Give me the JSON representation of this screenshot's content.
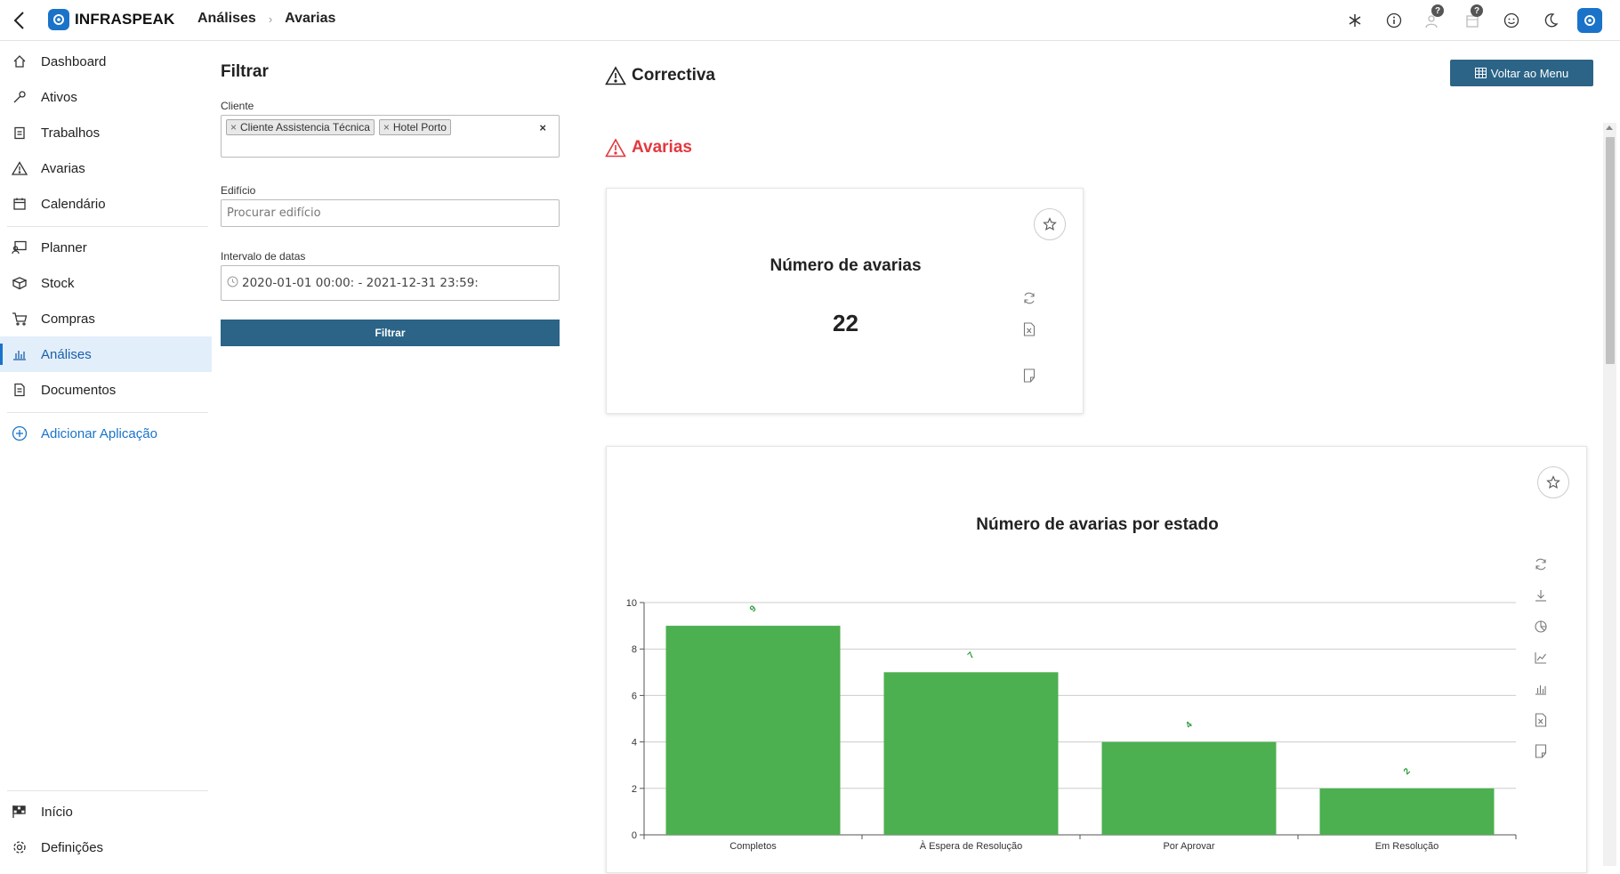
{
  "header": {
    "brand": "INFRASPEAK",
    "breadcrumb": [
      "Análises",
      "Avarias"
    ],
    "icons": [
      "asterisk-icon",
      "info-icon",
      "team-help-icon",
      "calendar-help-icon",
      "smiley-icon",
      "moon-icon",
      "app-avatar-icon"
    ]
  },
  "sidebar": {
    "items": [
      {
        "label": "Dashboard",
        "icon": "home-icon"
      },
      {
        "label": "Ativos",
        "icon": "wrench-icon"
      },
      {
        "label": "Trabalhos",
        "icon": "clipboard-icon"
      },
      {
        "label": "Avarias",
        "icon": "warning-icon"
      },
      {
        "label": "Calendário",
        "icon": "calendar-icon"
      },
      {
        "label": "Planner",
        "icon": "planner-icon"
      },
      {
        "label": "Stock",
        "icon": "box-icon"
      },
      {
        "label": "Compras",
        "icon": "cart-icon"
      },
      {
        "label": "Análises",
        "icon": "bar-chart-icon",
        "active": true
      },
      {
        "label": "Documentos",
        "icon": "document-icon"
      }
    ],
    "add_app": "Adicionar Aplicação",
    "bottom": [
      {
        "label": "Início",
        "icon": "flag-icon"
      },
      {
        "label": "Definições",
        "icon": "settings-icon"
      }
    ]
  },
  "filter": {
    "title": "Filtrar",
    "client_label": "Cliente",
    "client_tags": [
      "Cliente Assistencia Técnica",
      "Hotel Porto"
    ],
    "clear": "×",
    "building_label": "Edifício",
    "building_placeholder": "Procurar edifício",
    "date_label": "Intervalo de datas",
    "date_value": "2020-01-01 00:00: - 2021-12-31 23:59:",
    "button": "Filtrar"
  },
  "main": {
    "title": "Correctiva",
    "back_button": "Voltar ao Menu",
    "section_title": "Avarias"
  },
  "kpi_card": {
    "title": "Número de avarias",
    "value": "22"
  },
  "chart_card": {
    "title": "Número de avarias por estado"
  },
  "chart_data": {
    "type": "bar",
    "title": "Número de avarias por estado",
    "categories": [
      "Completos",
      "À Espera de Resolução",
      "Por Aprovar",
      "Em Resolução"
    ],
    "values": [
      9,
      7,
      4,
      2
    ],
    "data_labels": [
      "9",
      "7",
      "4",
      "2"
    ],
    "ylim": [
      0,
      10
    ],
    "yticks": [
      0,
      2,
      4,
      6,
      8,
      10
    ],
    "grid": true,
    "bar_color": "#4caf50",
    "label_color": "#2e9e3e"
  },
  "colors": {
    "accent": "#1a73c9",
    "button": "#2b6487",
    "danger": "#e2383f",
    "active_bg": "#e3eefb"
  }
}
